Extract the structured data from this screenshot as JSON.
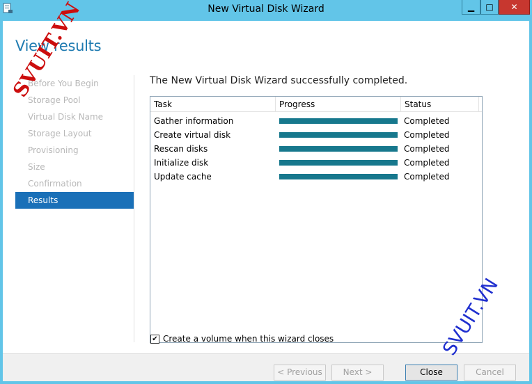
{
  "window": {
    "title": "New Virtual Disk Wizard",
    "minimize_glyph": "▁",
    "maximize_glyph": "□",
    "close_glyph": "✕"
  },
  "heading": "View results",
  "nav": {
    "items": [
      {
        "label": "Before You Begin",
        "active": false
      },
      {
        "label": "Storage Pool",
        "active": false
      },
      {
        "label": "Virtual Disk Name",
        "active": false
      },
      {
        "label": "Storage Layout",
        "active": false
      },
      {
        "label": "Provisioning",
        "active": false
      },
      {
        "label": "Size",
        "active": false
      },
      {
        "label": "Confirmation",
        "active": false
      },
      {
        "label": "Results",
        "active": true
      }
    ]
  },
  "message": "The New Virtual Disk Wizard successfully completed.",
  "table": {
    "columns": [
      "Task",
      "Progress",
      "Status"
    ],
    "rows": [
      {
        "task": "Gather information",
        "progress": 100,
        "status": "Completed"
      },
      {
        "task": "Create virtual disk",
        "progress": 100,
        "status": "Completed"
      },
      {
        "task": "Rescan disks",
        "progress": 100,
        "status": "Completed"
      },
      {
        "task": "Initialize disk",
        "progress": 100,
        "status": "Completed"
      },
      {
        "task": "Update cache",
        "progress": 100,
        "status": "Completed"
      }
    ]
  },
  "checkbox": {
    "label": "Create a volume when this wizard closes",
    "checked": true,
    "glyph": "✔"
  },
  "buttons": {
    "previous": "< Previous",
    "next": "Next >",
    "close": "Close",
    "cancel": "Cancel"
  },
  "watermarks": {
    "top_left": "SVUIT.VN",
    "bottom_right": "SVUIT.VN"
  },
  "colors": {
    "accent": "#1a70b8",
    "progress_fill": "#17788d",
    "titlebar": "#62c5e8"
  }
}
